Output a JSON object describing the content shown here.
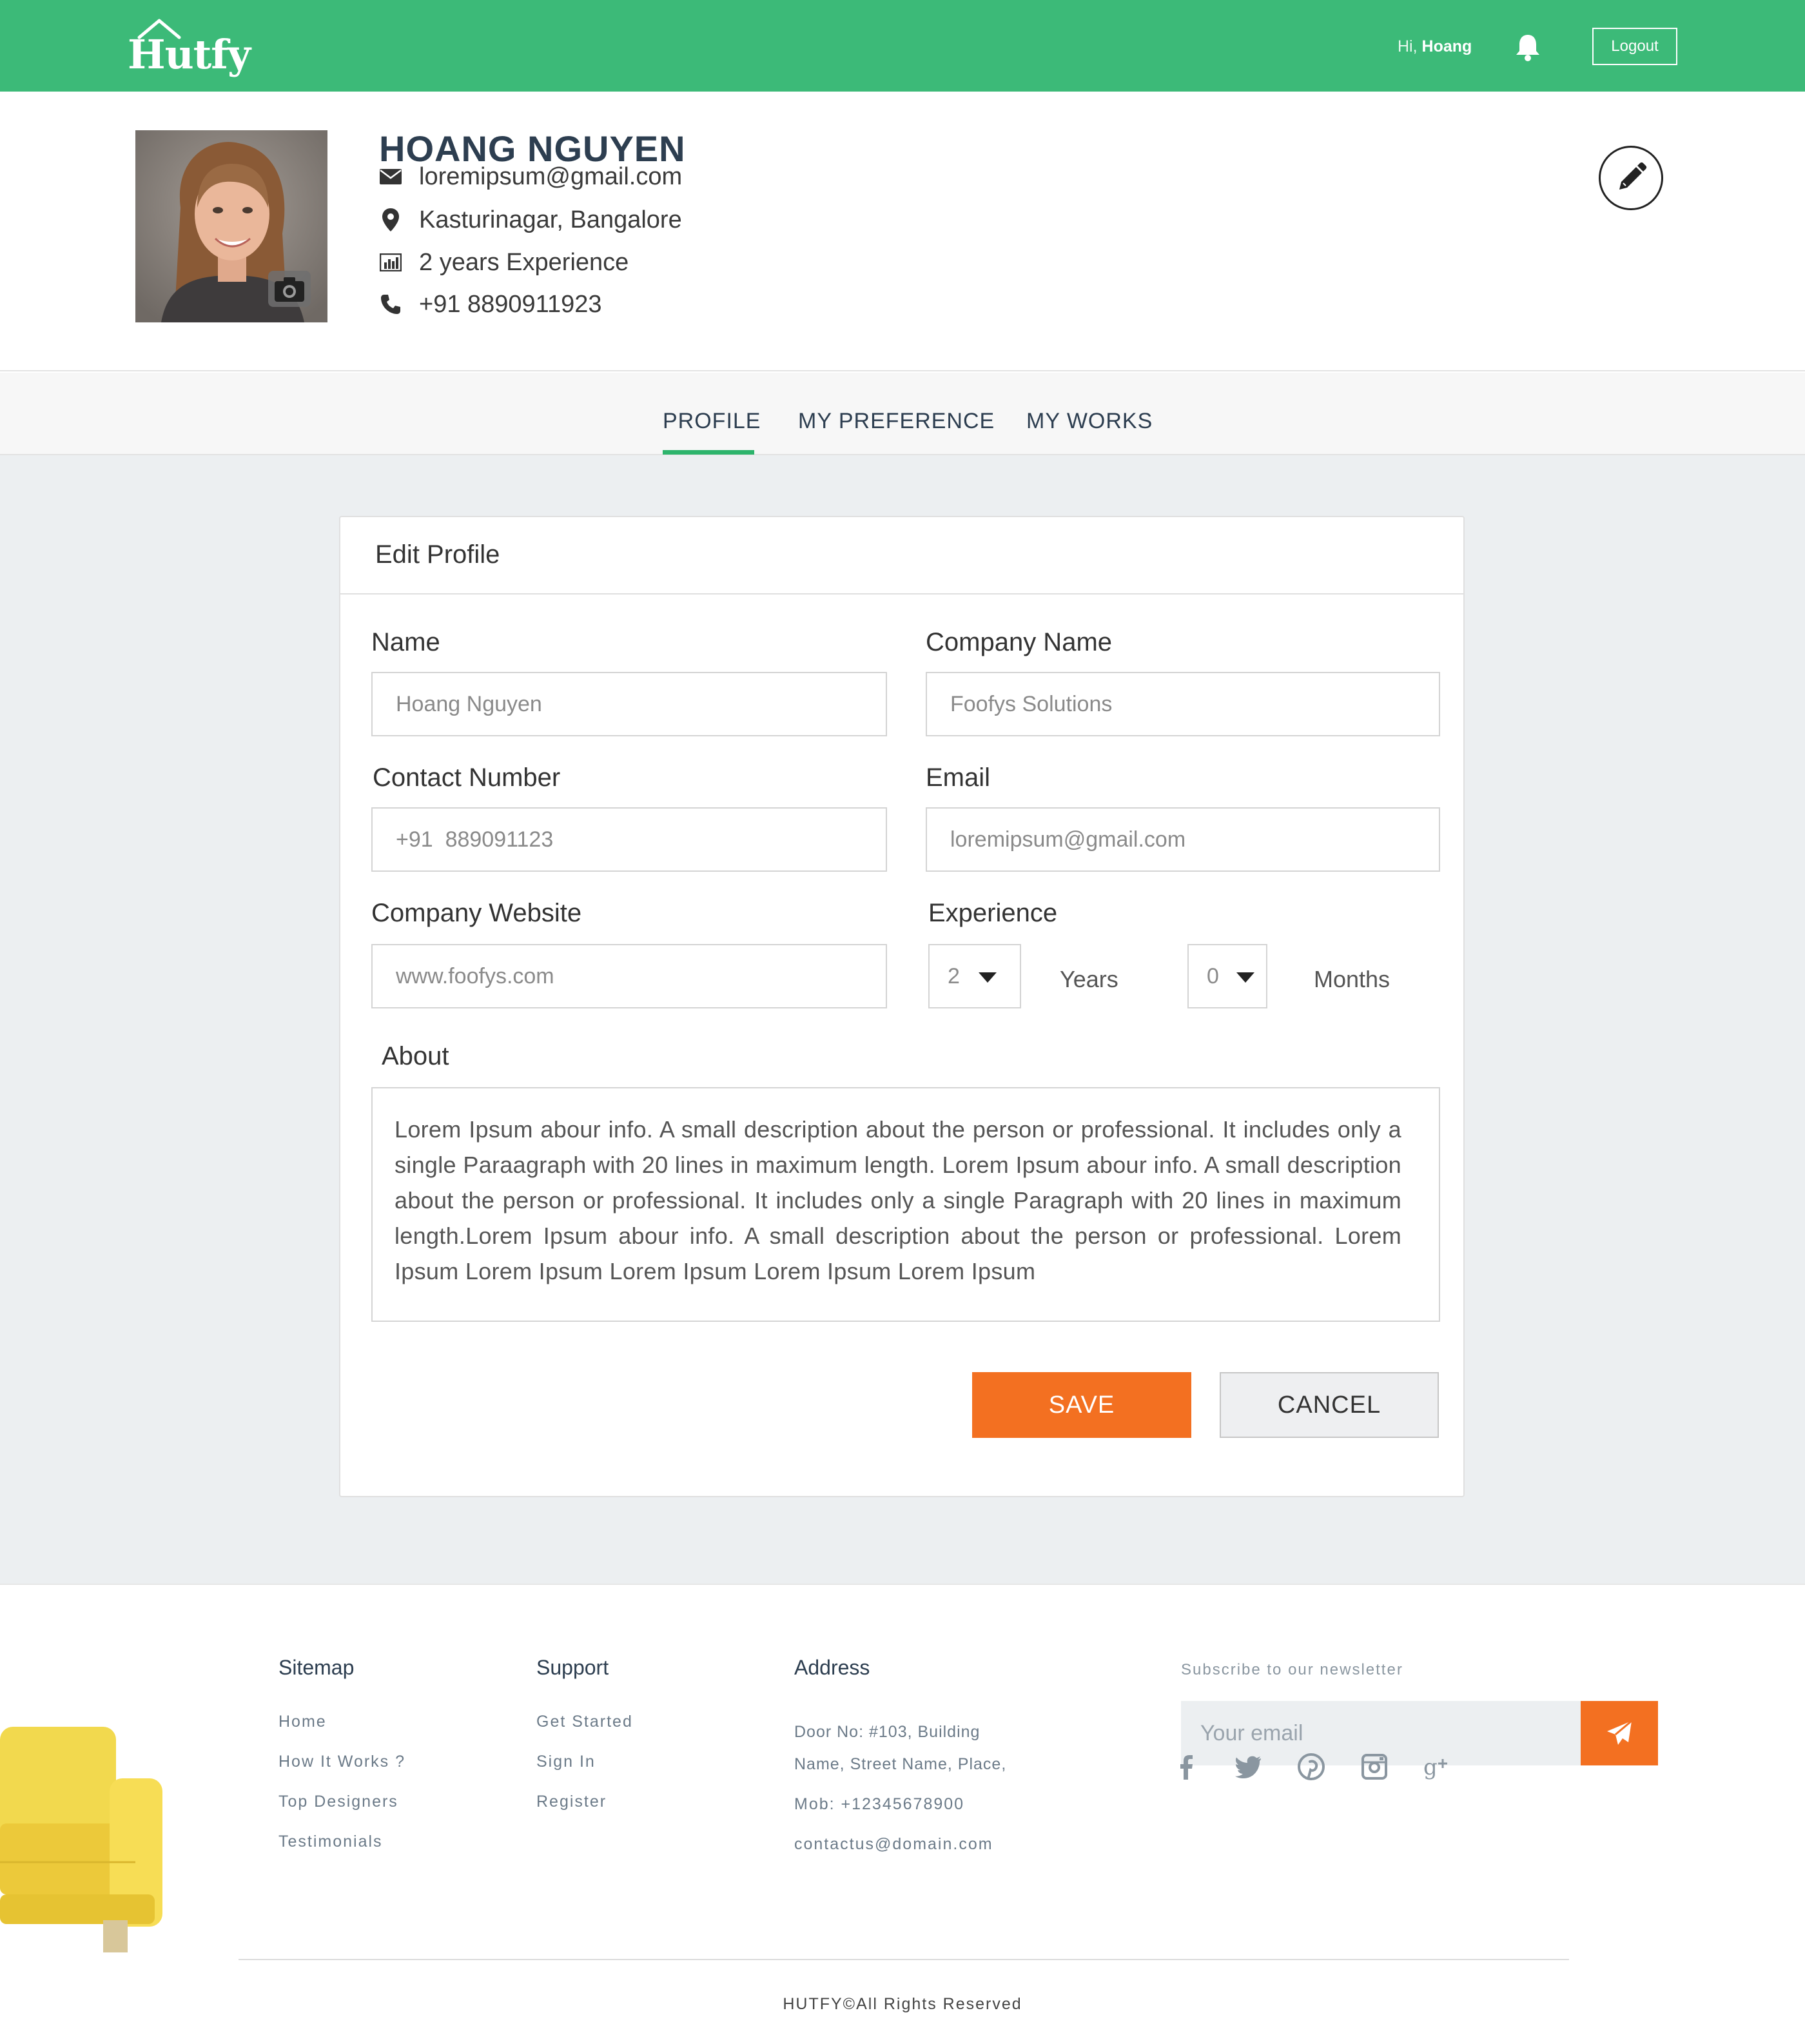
{
  "header": {
    "logo_text": "Hutfy",
    "greeting_prefix": "Hi,",
    "greeting_name": "Hoang",
    "logout_label": "Logout",
    "brand_color": "#3cba78"
  },
  "profile": {
    "name": "HOANG NGUYEN",
    "email": "loremipsum@gmail.com",
    "location": "Kasturinagar, Bangalore",
    "experience": "2 years Experience",
    "phone": "+91 8890911923"
  },
  "tabs": [
    {
      "label": "PROFILE",
      "active": true
    },
    {
      "label": "MY PREFERENCE",
      "active": false
    },
    {
      "label": "MY WORKS",
      "active": false
    }
  ],
  "form": {
    "title": "Edit Profile",
    "name_label": "Name",
    "name_value": "Hoang Nguyen",
    "company_label": "Company Name",
    "company_value": "Foofys Solutions",
    "contact_label": "Contact Number",
    "contact_value": "+91  889091123",
    "email_label": "Email",
    "email_value": "loremipsum@gmail.com",
    "website_label": "Company Website",
    "website_value": "www.foofys.com",
    "experience_label": "Experience",
    "years_value": "2",
    "years_unit": "Years",
    "months_value": "0",
    "months_unit": "Months",
    "about_label": "About",
    "about_value": "Lorem Ipsum abour info. A small description about the person or professional. It includes only a single Paraagraph with 20 lines in maximum length. Lorem Ipsum abour info. A small description about the person or professional. It includes only a single Paragraph with 20 lines in maximum length.Lorem Ipsum abour info. A small description about the person or professional. Lorem Ipsum Lorem Ipsum Lorem Ipsum Lorem Ipsum Lorem Ipsum",
    "save_label": "SAVE",
    "cancel_label": "CANCEL",
    "accent_color": "#f37021"
  },
  "footer": {
    "sitemap": {
      "title": "Sitemap",
      "links": [
        "Home",
        "How It Works ?",
        "Top Designers",
        "Testimonials"
      ]
    },
    "support": {
      "title": "Support",
      "links": [
        "Get Started",
        "Sign In",
        "Register"
      ]
    },
    "address": {
      "title": "Address",
      "line1": "Door No: #103, Building",
      "line2": "Name, Street Name, Place,",
      "mobile": "Mob: +12345678900",
      "email": "contactus@domain.com"
    },
    "newsletter": {
      "title": "Subscribe to our newsletter",
      "placeholder": "Your email"
    },
    "social_icons": [
      "facebook-icon",
      "twitter-icon",
      "pinterest-icon",
      "instagram-icon",
      "google-plus-icon"
    ],
    "copyright": "HUTFY©All Rights Reserved"
  }
}
